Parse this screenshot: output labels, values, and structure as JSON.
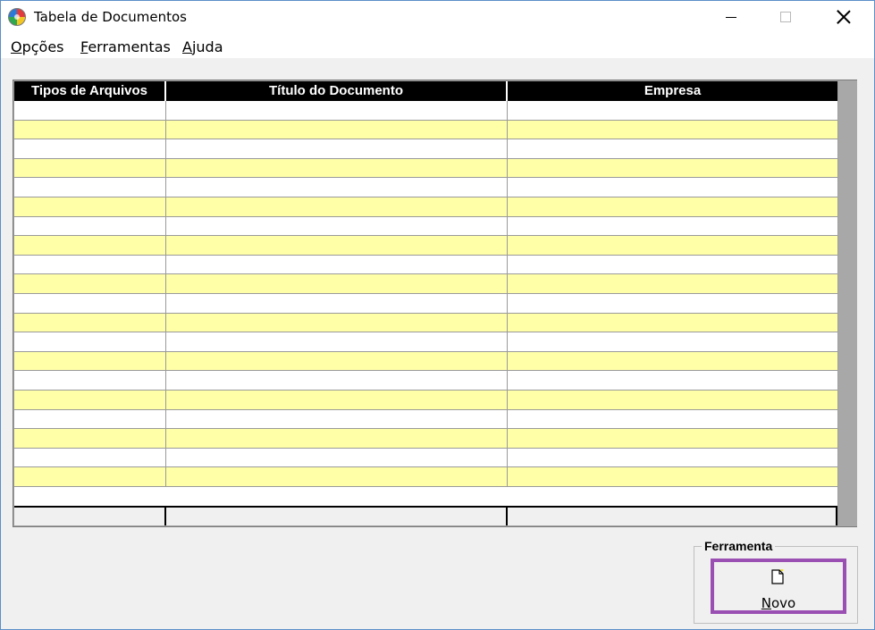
{
  "window": {
    "title": "Tabela de Documentos"
  },
  "menu": {
    "items": [
      {
        "ul": "O",
        "rest": "pções"
      },
      {
        "ul": "F",
        "rest": "erramentas"
      },
      {
        "ul": "A",
        "rest": "juda"
      }
    ]
  },
  "table": {
    "columns": [
      "Tipos de Arquivos",
      "Título do Documento",
      "Empresa"
    ],
    "row_count": 20,
    "row_colors": {
      "odd": "#ffffff",
      "even": "#ffffa8"
    },
    "header_color": "#000000"
  },
  "tools": {
    "group_label": "Ferramenta",
    "novo_ul": "N",
    "novo_rest": "ovo",
    "novo_icon": "new-document-icon"
  },
  "colors": {
    "highlight_border": "#9a4fb3",
    "window_border": "#5a8fc8"
  }
}
